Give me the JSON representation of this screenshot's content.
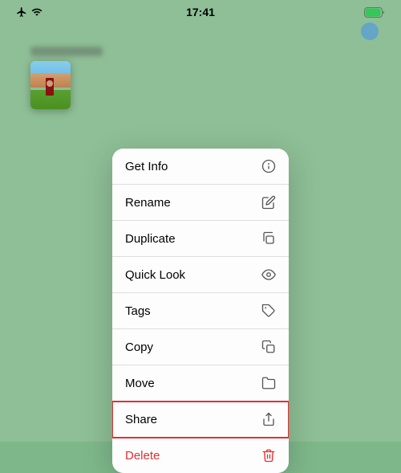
{
  "statusBar": {
    "time": "17:41",
    "signal": "▲",
    "wifi": "wifi",
    "battery": "battery"
  },
  "background": {
    "color": "#7eb88a"
  },
  "blueDot": {
    "visible": true
  },
  "contextMenu": {
    "items": [
      {
        "id": "get-info",
        "label": "Get Info",
        "icon": "info",
        "highlighted": false,
        "isDelete": false
      },
      {
        "id": "rename",
        "label": "Rename",
        "icon": "pencil",
        "highlighted": false,
        "isDelete": false
      },
      {
        "id": "duplicate",
        "label": "Duplicate",
        "icon": "duplicate",
        "highlighted": false,
        "isDelete": false
      },
      {
        "id": "quick-look",
        "label": "Quick Look",
        "icon": "eye",
        "highlighted": false,
        "isDelete": false
      },
      {
        "id": "tags",
        "label": "Tags",
        "icon": "tag",
        "highlighted": false,
        "isDelete": false
      },
      {
        "id": "copy",
        "label": "Copy",
        "icon": "copy",
        "highlighted": false,
        "isDelete": false
      },
      {
        "id": "move",
        "label": "Move",
        "icon": "folder",
        "highlighted": false,
        "isDelete": false
      },
      {
        "id": "share",
        "label": "Share",
        "icon": "share",
        "highlighted": true,
        "isDelete": false
      },
      {
        "id": "delete",
        "label": "Delete",
        "icon": "trash",
        "highlighted": false,
        "isDelete": true
      }
    ]
  }
}
